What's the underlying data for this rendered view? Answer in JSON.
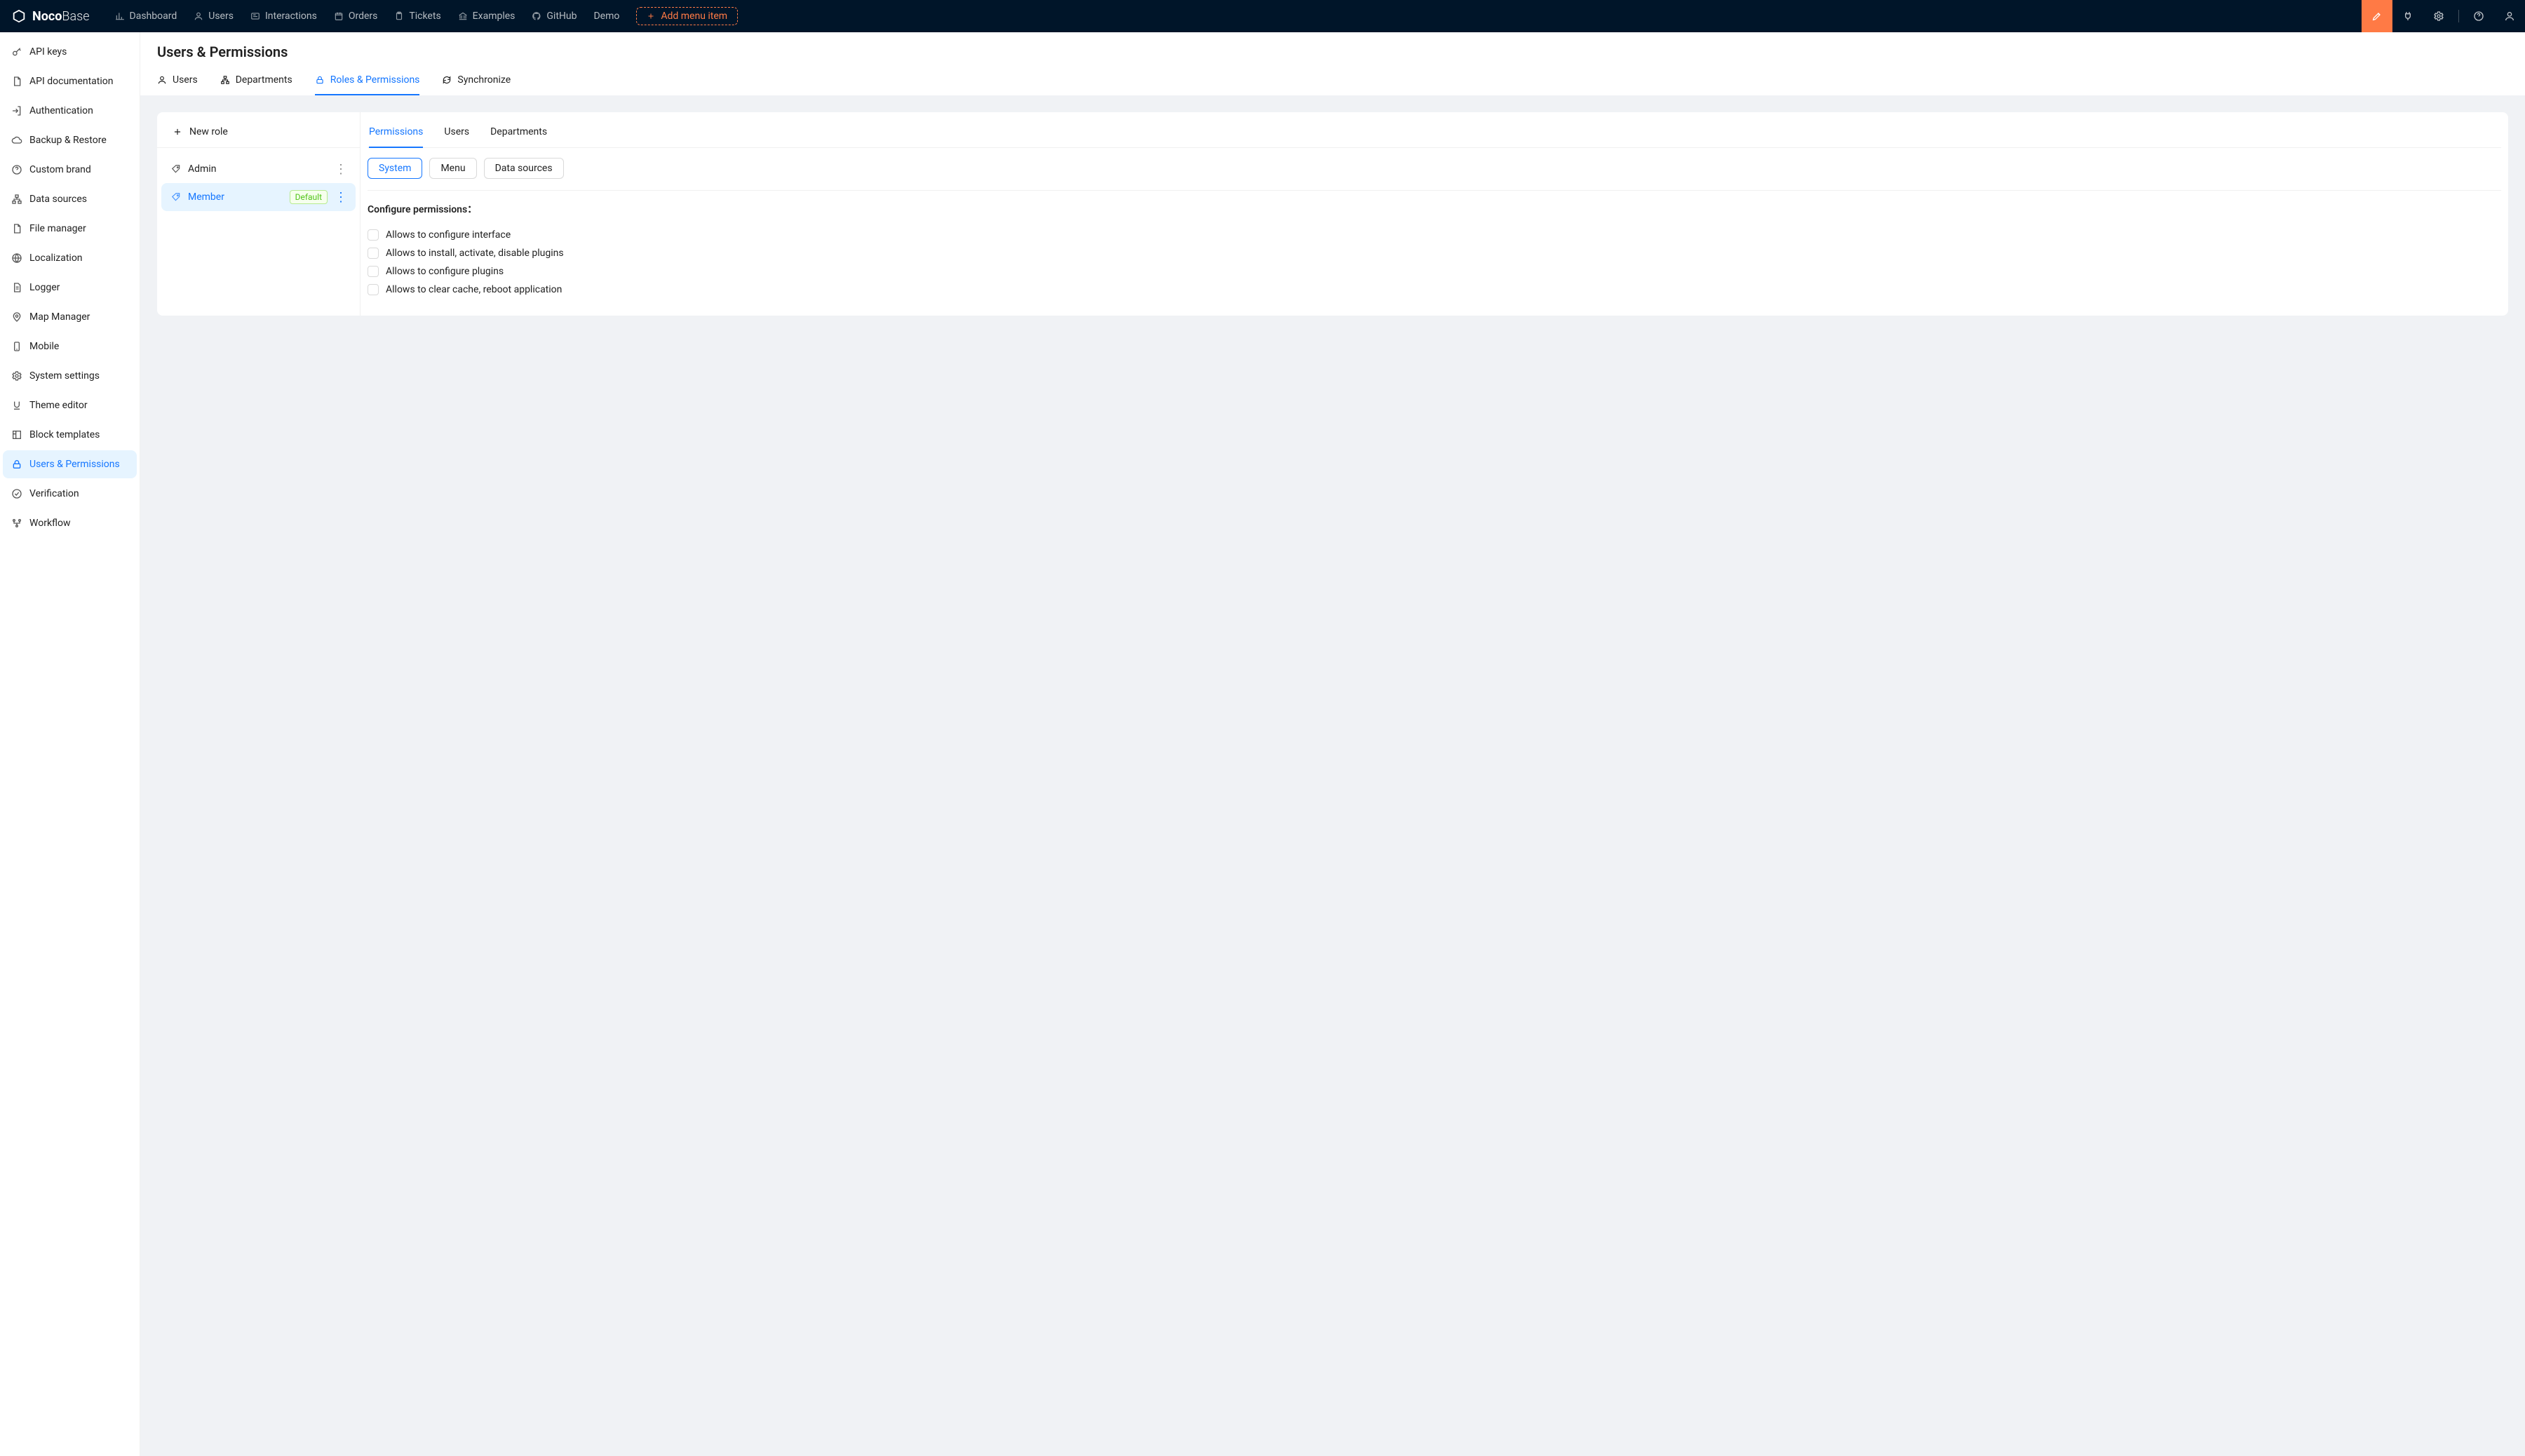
{
  "brand": {
    "name1": "Noco",
    "name2": "Base"
  },
  "topnav": {
    "items": [
      {
        "label": "Dashboard"
      },
      {
        "label": "Users"
      },
      {
        "label": "Interactions"
      },
      {
        "label": "Orders"
      },
      {
        "label": "Tickets"
      },
      {
        "label": "Examples"
      },
      {
        "label": "GitHub"
      },
      {
        "label": "Demo"
      }
    ],
    "add_menu_label": "Add menu item"
  },
  "sidebar": {
    "items": [
      {
        "label": "API keys"
      },
      {
        "label": "API documentation"
      },
      {
        "label": "Authentication"
      },
      {
        "label": "Backup & Restore"
      },
      {
        "label": "Custom brand"
      },
      {
        "label": "Data sources"
      },
      {
        "label": "File manager"
      },
      {
        "label": "Localization"
      },
      {
        "label": "Logger"
      },
      {
        "label": "Map Manager"
      },
      {
        "label": "Mobile"
      },
      {
        "label": "System settings"
      },
      {
        "label": "Theme editor"
      },
      {
        "label": "Block templates"
      },
      {
        "label": "Users & Permissions"
      },
      {
        "label": "Verification"
      },
      {
        "label": "Workflow"
      }
    ],
    "active_index": 14
  },
  "page": {
    "title": "Users & Permissions"
  },
  "page_tabs": {
    "items": [
      {
        "label": "Users"
      },
      {
        "label": "Departments"
      },
      {
        "label": "Roles & Permissions"
      },
      {
        "label": "Synchronize"
      }
    ],
    "active_index": 2
  },
  "roles": {
    "new_role_label": "New role",
    "items": [
      {
        "name": "Admin",
        "default": false
      },
      {
        "name": "Member",
        "default": true
      }
    ],
    "default_badge": "Default",
    "active_index": 1
  },
  "detail_tabs": {
    "items": [
      {
        "label": "Permissions"
      },
      {
        "label": "Users"
      },
      {
        "label": "Departments"
      }
    ],
    "active_index": 0
  },
  "seg_tabs": {
    "items": [
      {
        "label": "System"
      },
      {
        "label": "Menu"
      },
      {
        "label": "Data sources"
      }
    ],
    "active_index": 0
  },
  "permissions": {
    "heading": "Configure permissions：",
    "items": [
      {
        "label": "Allows to configure interface",
        "checked": false
      },
      {
        "label": "Allows to install, activate, disable plugins",
        "checked": false
      },
      {
        "label": "Allows to configure plugins",
        "checked": false
      },
      {
        "label": "Allows to clear cache, reboot application",
        "checked": false
      }
    ]
  }
}
